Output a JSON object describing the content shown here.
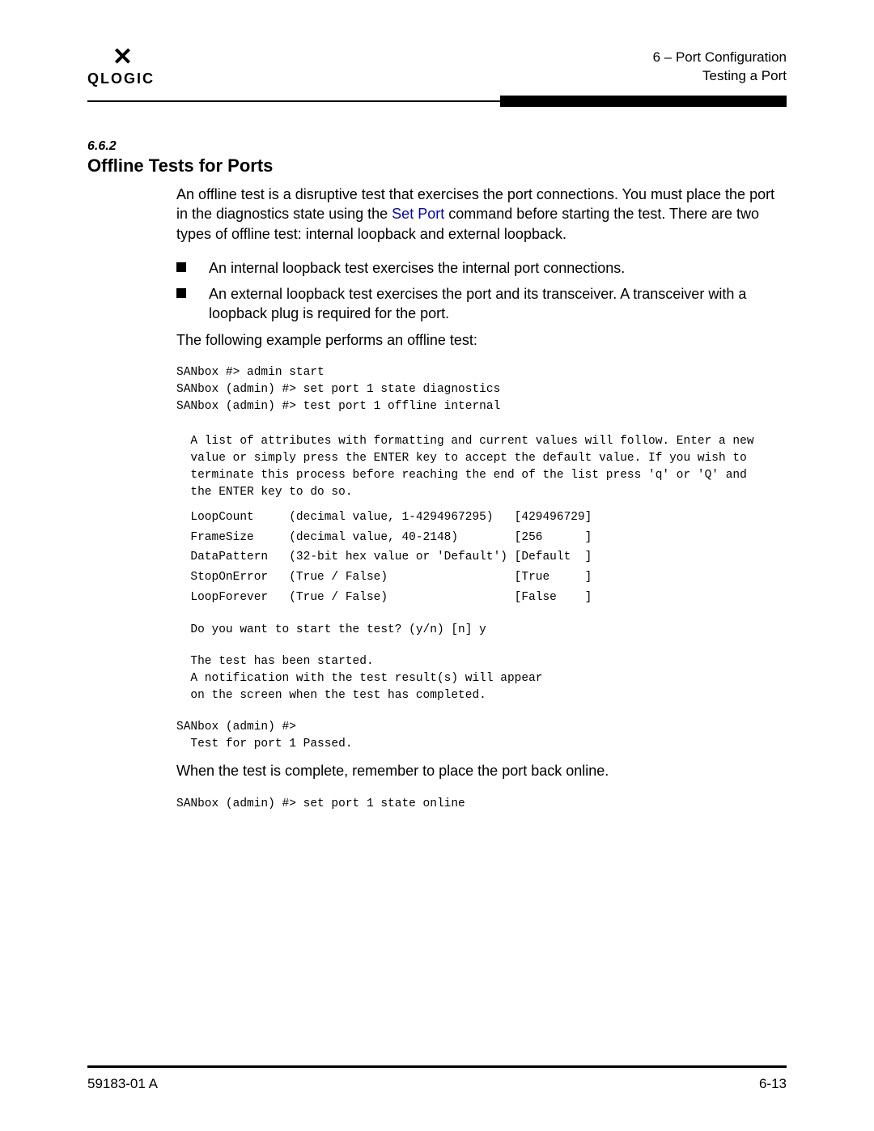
{
  "header": {
    "logo_text": "QLOGIC",
    "chapter_label": "6 – Port Configuration",
    "breadcrumb": "Testing a Port"
  },
  "section": {
    "number": "6.6.2",
    "title": "Offline Tests for Ports"
  },
  "body": {
    "intro_a": "An offline test is a disruptive test that exercises the port connections. You must place the port in the diagnostics state using the ",
    "intro_link": "Set Port",
    "intro_b": " command before starting the test. There are two types of offline test: internal loopback and external loopback.",
    "bullets": [
      "An internal loopback test exercises the internal port connections.",
      "An external loopback test exercises the port and its transceiver. A transceiver with a loopback plug is required for the port."
    ],
    "example_lead": "The following example performs an offline test:",
    "term_cmds": "SANbox #> admin start\nSANbox (admin) #> set port 1 state diagnostics\nSANbox (admin) #> test port 1 offline internal",
    "attr_intro": "  A list of attributes with formatting and current values will follow. Enter a new\n  value or simply press the ENTER key to accept the default value. If you wish to\n  terminate this process before reaching the end of the list press 'q' or 'Q' and\n  the ENTER key to do so.",
    "attrs": [
      {
        "name": "LoopCount",
        "fmt": "(decimal value, 1-4294967295)",
        "val": "429496729"
      },
      {
        "name": "FrameSize",
        "fmt": "(decimal value, 40-2148)",
        "val": "256"
      },
      {
        "name": "DataPattern",
        "fmt": "(32-bit hex value or 'Default')",
        "val": "Default"
      },
      {
        "name": "StopOnError",
        "fmt": "(True / False)",
        "val": "True"
      },
      {
        "name": "LoopForever",
        "fmt": "(True / False)",
        "val": "False"
      }
    ],
    "confirm": "  Do you want to start the test? (y/n) [n] y",
    "started": "  The test has been started.\n  A notification with the test result(s) will appear\n  on the screen when the test has completed.",
    "result": "SANbox (admin) #>\n  Test for port 1 Passed.",
    "post_note": "When the test is complete, remember to place the port back online.",
    "post_cmd": "SANbox (admin) #> set port 1 state online"
  },
  "footer": {
    "doc_id": "59183-01 A",
    "page_num": "6-13"
  }
}
